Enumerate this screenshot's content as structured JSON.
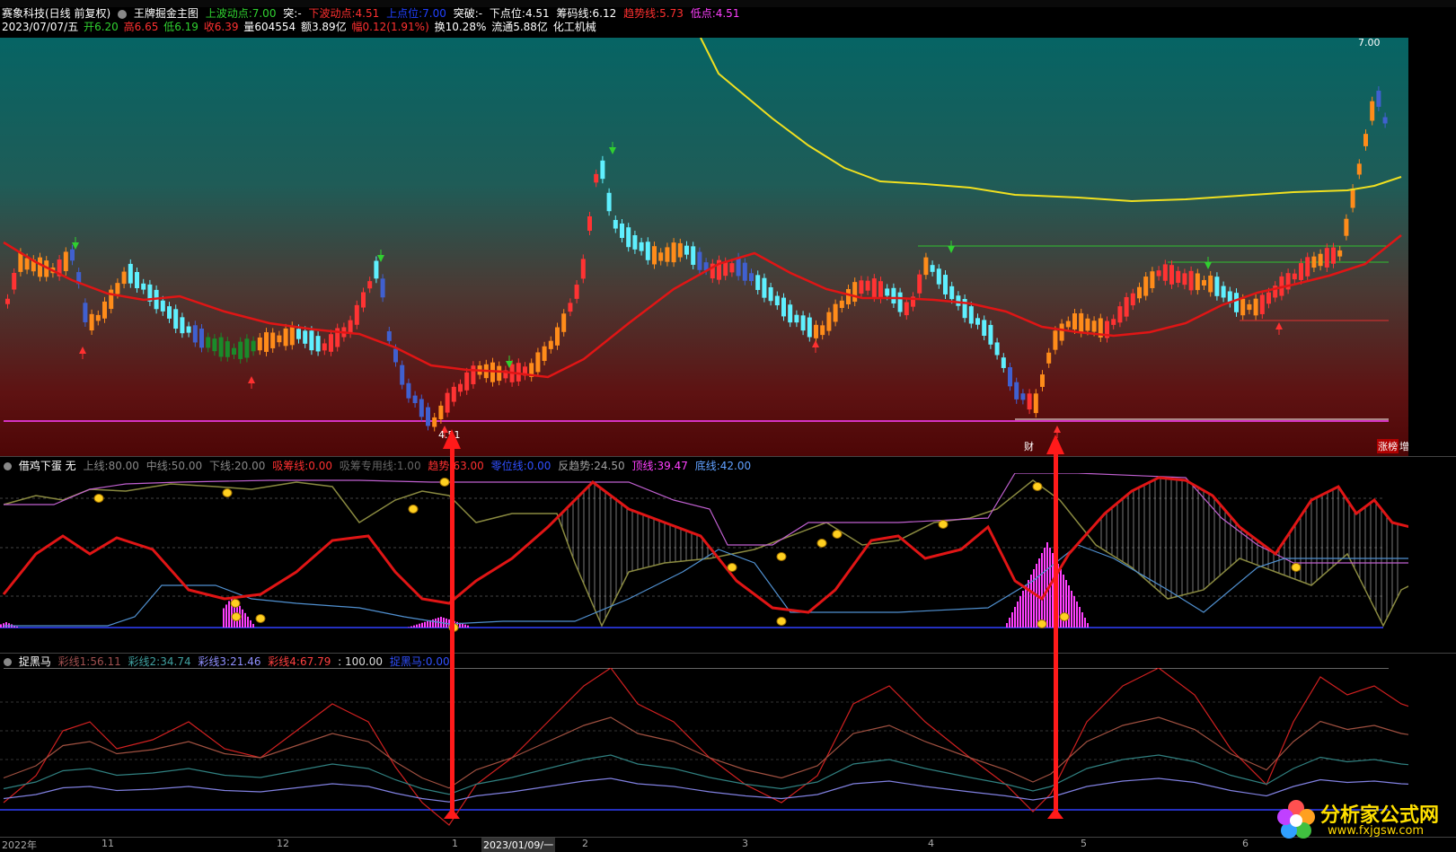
{
  "header": {
    "stock_name": "赛象科技(日线 前复权)",
    "main_indicator": "王牌掘金主图",
    "up_label": "上波动点:",
    "up_value": "7.00",
    "break_label": "突:",
    "break_value": "-",
    "down_label": "下波动点:",
    "down_value": "4.51",
    "top_label": "上点位:",
    "top_value": "7.00",
    "tupo_label": "突破:",
    "tupo_value": "-",
    "low_label": "下点位:",
    "low_value": "4.51",
    "chip_label": "筹码线:",
    "chip_value": "6.12",
    "trend_label": "趋势线:",
    "trend_value": "5.73",
    "dip_label": "低点:",
    "dip_value": "4.51"
  },
  "quote": {
    "date": "2023/07/07/五",
    "open_label": "开",
    "open": "6.20",
    "high_label": "高",
    "high": "6.65",
    "low_label": "低",
    "low": "6.19",
    "close_label": "收",
    "close": "6.39",
    "vol_label": "量",
    "vol": "604554",
    "amt_label": "额",
    "amt": "3.89亿",
    "chg_label": "幅",
    "chg": "0.12(1.91%)",
    "turn_label": "换",
    "turn": "10.28%",
    "float_label": "流通",
    "float": "5.88亿",
    "industry": "化工机械"
  },
  "main_chart": {
    "price_high_label": "7.00",
    "price_low_label": "4.51",
    "tag_cai": "财",
    "tag_zeng": "增",
    "tag_rank": "涨榜"
  },
  "panel2": {
    "name": "借鸡下蛋",
    "mode": "无",
    "up_label": "上线:",
    "up": "80.00",
    "mid_label": "中线:",
    "mid": "50.00",
    "low_label": "下线:",
    "low": "20.00",
    "absorb_label": "吸筹线:",
    "absorb": "0.00",
    "absorb2_label": "吸筹专用线:",
    "absorb2": "1.00",
    "trend_label": "趋势:",
    "trend": "63.00",
    "zero_label": "零位线:",
    "zero": "0.00",
    "rev_label": "反趋势:",
    "rev": "24.50",
    "top_label": "顶线:",
    "top": "39.47",
    "bottom_label": "底线:",
    "bottom": "42.00"
  },
  "panel3": {
    "name": "捉黑马",
    "c1_label": "彩线1:",
    "c1": "56.11",
    "c2_label": "彩线2:",
    "c2": "34.74",
    "c3_label": "彩线3:",
    "c3": "21.46",
    "c4_label": "彩线4:",
    "c4": "67.79",
    "c5": ": 100.00",
    "horse_label": "捉黑马:",
    "horse": "0.00"
  },
  "xaxis": {
    "labels": [
      "2022年",
      "11",
      "12",
      "1",
      "2023/01/09/一",
      "2",
      "3",
      "4",
      "5",
      "6"
    ]
  },
  "watermark": {
    "title": "分析家公式网",
    "url": "www.fxjgsw.com"
  },
  "colors": {
    "up": "#ff3333",
    "down": "#4060d0",
    "cyan": "#5ff0ff",
    "orange": "#ff8c1a",
    "green": "#1a8a2a",
    "yellow": "#f0e020",
    "red_line": "#e01010",
    "magenta": "#ff40ff"
  }
}
